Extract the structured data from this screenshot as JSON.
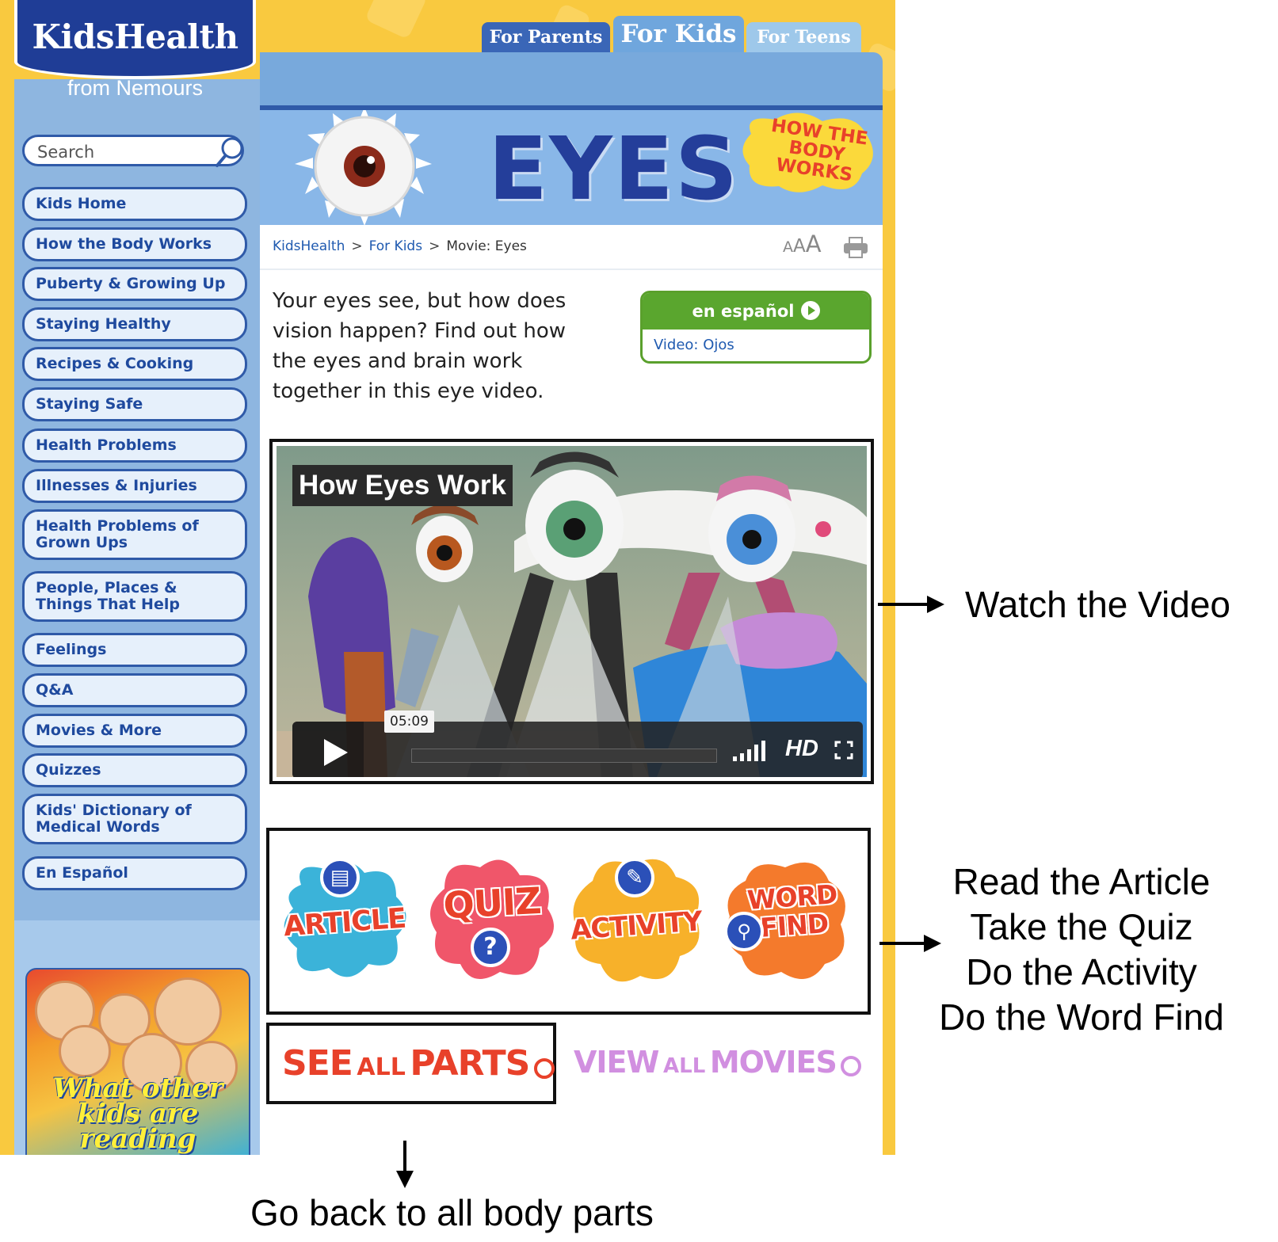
{
  "logo": {
    "title": "KidsHealth",
    "subtitle": "from Nemours"
  },
  "tabs": [
    {
      "label": "For Parents"
    },
    {
      "label": "For Kids"
    },
    {
      "label": "For Teens"
    }
  ],
  "search": {
    "placeholder": "Search"
  },
  "sidebar": {
    "items": [
      {
        "label": "Kids Home"
      },
      {
        "label": "How the Body Works"
      },
      {
        "label": "Puberty & Growing Up"
      },
      {
        "label": "Staying Healthy"
      },
      {
        "label": "Recipes & Cooking"
      },
      {
        "label": "Staying Safe"
      },
      {
        "label": "Health Problems"
      },
      {
        "label": "Illnesses & Injuries"
      },
      {
        "label": "Health Problems of Grown Ups"
      },
      {
        "label": "People, Places & Things That Help"
      },
      {
        "label": "Feelings"
      },
      {
        "label": "Q&A"
      },
      {
        "label": "Movies & More"
      },
      {
        "label": "Quizzes"
      },
      {
        "label": "Kids' Dictionary of Medical Words"
      },
      {
        "label": "En Español"
      }
    ],
    "promo_label": "What other kids are reading"
  },
  "banner": {
    "title": "EYES",
    "badge": "HOW THE BODY WORKS"
  },
  "breadcrumb": {
    "home": "KidsHealth",
    "section": "For Kids",
    "current": "Movie: Eyes"
  },
  "text_size": {
    "small": "A",
    "medium": "A",
    "large": "A"
  },
  "intro": "Your eyes see, but how does vision happen? Find out how the eyes and brain work together in this eye video.",
  "espanol": {
    "header": "en español",
    "link": "Video: Ojos"
  },
  "video": {
    "title": "How Eyes Work",
    "time": "05:09",
    "quality": "HD",
    "progress": 0.0
  },
  "activities": [
    {
      "label": "ARTICLE",
      "icon": "document-icon",
      "color": "#3bb3d9"
    },
    {
      "label": "QUIZ",
      "icon": "question-icon",
      "color": "#f0566a"
    },
    {
      "label": "ACTIVITY",
      "icon": "pencil-icon",
      "color": "#f7b12a"
    },
    {
      "label": "WORD FIND",
      "icon": "magnifier-icon",
      "color": "#f47a2c"
    }
  ],
  "see_all": {
    "big": "SEE",
    "small": "ALL",
    "big2": "PARTS"
  },
  "view_movies": {
    "big": "VIEW",
    "small": "ALL",
    "big2": "MOVIES"
  },
  "annotations": {
    "video": "Watch the Video",
    "activities": [
      "Read the Article",
      "Take the Quiz",
      "Do the Activity",
      "Do the Word Find"
    ],
    "back": "Go back to all body parts"
  },
  "colors": {
    "brand_blue": "#1f3d96",
    "page_yellow": "#f9c93f",
    "nav_text": "#1f4a9e",
    "espanol_green": "#5aa62e"
  }
}
